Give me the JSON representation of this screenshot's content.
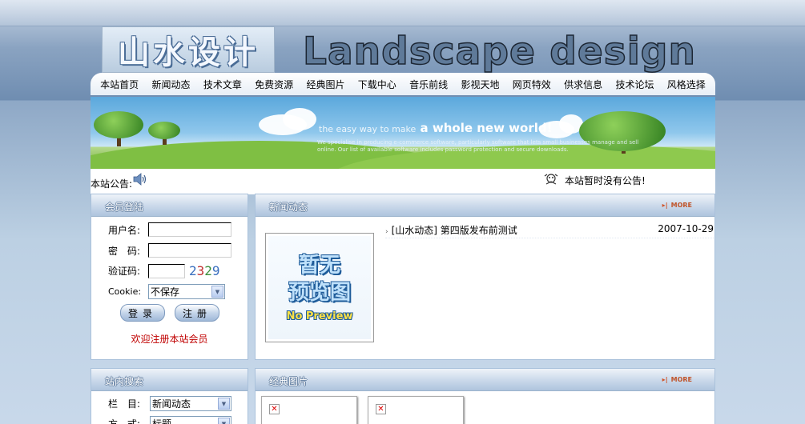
{
  "header": {
    "logo_cn": "山水设计",
    "logo_en": "Landscape design"
  },
  "nav": {
    "items": [
      "本站首页",
      "新闻动态",
      "技术文章",
      "免费资源",
      "经典图片",
      "下载中心",
      "音乐前线",
      "影视天地",
      "网页特效",
      "供求信息",
      "技术论坛",
      "风格选择"
    ]
  },
  "banner": {
    "headline_pre": "the easy way to make",
    "headline": "a whole new world!",
    "subtext": "We specialise in producing e-commerce software, particularly software that lets small businesses manage and sell online. Our list of available software includes password protection and secure downloads."
  },
  "notice": {
    "label": "本站公告:",
    "text": "本站暂时没有公告!"
  },
  "login": {
    "title": "会员登陆",
    "username_label": "用户名:",
    "password_label": "密　码:",
    "captcha_label": "验证码:",
    "captcha": [
      "2",
      "3",
      "2",
      "9"
    ],
    "cookie_label": "Cookie:",
    "cookie_value": "不保存",
    "login_button": "登录",
    "register_button": "注册",
    "welcome": "欢迎注册本站会员"
  },
  "news": {
    "title": "新闻动态",
    "more": "MORE",
    "preview_cn_1": "暂无",
    "preview_cn_2": "预览图",
    "preview_en": "No Preview",
    "items": [
      {
        "text": "[山水动态] 第四版发布前测试",
        "date": "2007-10-29"
      }
    ]
  },
  "search": {
    "title": "站内搜索",
    "column_label": "栏　目:",
    "column_value": "新闻动态",
    "mode_label": "方　式:",
    "mode_value": "标题"
  },
  "gallery": {
    "title": "经典图片",
    "more": "MORE"
  },
  "colors": {
    "accent": "#a9c1db",
    "welcome": "#c00000",
    "more": "#c0542a"
  },
  "captcha_colors": [
    "#3a6fbf",
    "#c03030",
    "#3a8f3a",
    "#3a6fbf"
  ]
}
